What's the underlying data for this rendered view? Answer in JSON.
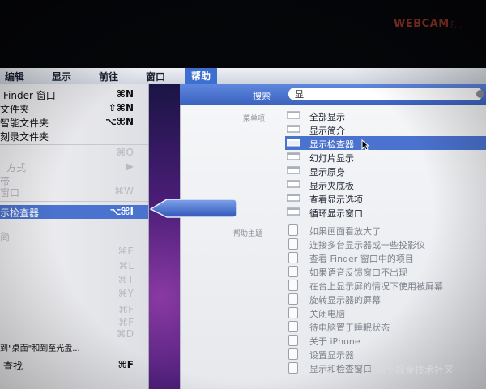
{
  "overlay": {
    "webcam_text": "WEBCAM",
    "webcam_tail": "F...",
    "watermark": "@稀土掘金技术社区"
  },
  "menubar": {
    "items": [
      "编辑",
      "显示",
      "前往",
      "窗口",
      "帮助"
    ],
    "active": "帮助"
  },
  "file_menu": {
    "rows": [
      {
        "label": "Finder 窗口",
        "shortcut": "⌘N"
      },
      {
        "label": "文件夹",
        "shortcut": "⇧⌘N"
      },
      {
        "label": "智能文件夹",
        "shortcut": "⌥⌘N"
      },
      {
        "label": "刻录文件夹",
        "shortcut": ""
      },
      {
        "label": "",
        "shortcut": "⌘O"
      },
      {
        "label": "方式",
        "shortcut": "▶"
      },
      {
        "label": "带",
        "shortcut": ""
      },
      {
        "label": "窗口",
        "shortcut": "⌘W"
      },
      {
        "label": "示检查器",
        "shortcut": "⌥⌘I"
      },
      {
        "label": "简",
        "shortcut": ""
      },
      {
        "label": "",
        "shortcut": "⌘E"
      },
      {
        "label": "",
        "shortcut": "⌘L"
      },
      {
        "label": "",
        "shortcut": "⌘T"
      },
      {
        "label": "",
        "shortcut": "⌘Y"
      },
      {
        "label": "",
        "shortcut": "⌘F"
      },
      {
        "label": "",
        "shortcut": "⌘F"
      },
      {
        "label": "",
        "shortcut": "⌘D"
      },
      {
        "label": "",
        "shortcut": ""
      },
      {
        "label": "到\"桌面\"和到至光盘...",
        "shortcut": ""
      },
      {
        "label": "查找",
        "shortcut": "⌘F"
      }
    ]
  },
  "help": {
    "search_label": "搜索",
    "search_value": "显",
    "menu_section": "菜单项",
    "menu_items": [
      "全部显示",
      "显示简介",
      "显示检查器",
      "幻灯片显示",
      "显示原身",
      "显示夹底板",
      "查看显示选项",
      "循环显示窗口"
    ],
    "selected_item": "显示检查器",
    "topics_section": "帮助主题",
    "topics": [
      "如果画面看放大了",
      "连接多台显示器或一些投影仪",
      "查看 Finder 窗口中的项目",
      "如果语音反馈窗口不出现",
      "在台上显示屏的情况下使用被屏幕",
      "旋转显示器的屏幕",
      "关闭电脑",
      "待电脑置于睡眠状态",
      "关于 iPhone",
      "设置显示器",
      "显示和检查窗口"
    ]
  }
}
